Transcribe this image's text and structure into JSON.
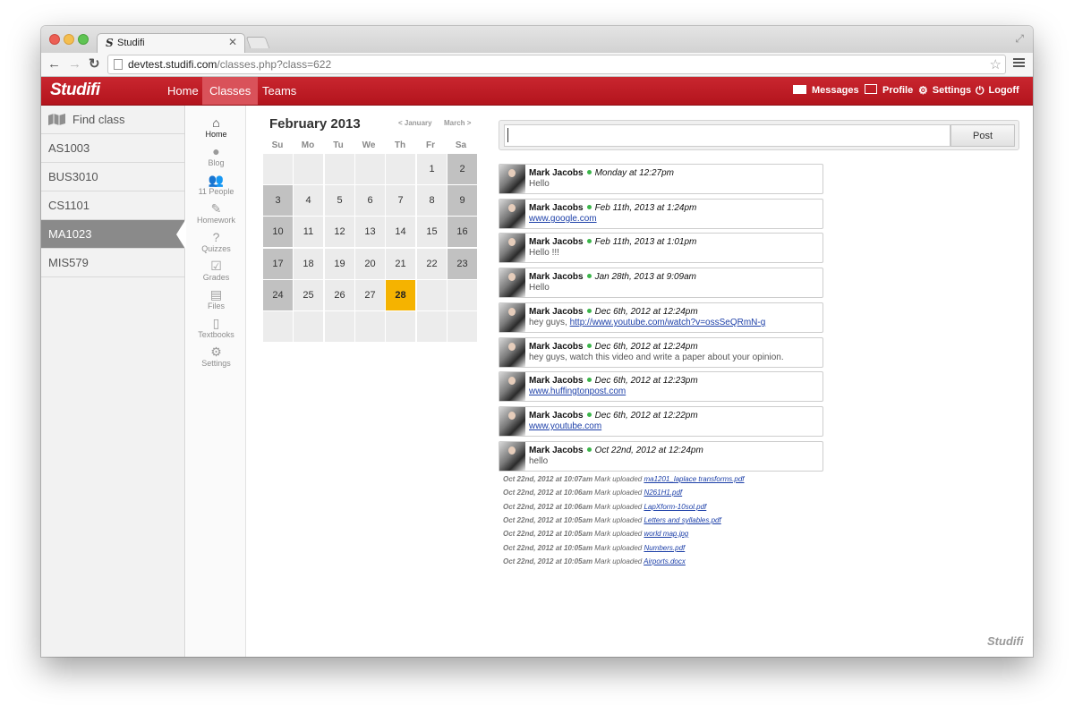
{
  "browser": {
    "tab_title": "Studifi",
    "favicon": "S",
    "url_host": "devtest.studifi.com",
    "url_path": "/classes.php?class=622"
  },
  "header": {
    "logo": "Studifi",
    "nav": [
      {
        "label": "Home"
      },
      {
        "label": "Classes"
      },
      {
        "label": "Teams"
      }
    ],
    "right": [
      {
        "label": "Messages",
        "icon": "envelope-icon"
      },
      {
        "label": "Profile",
        "icon": "id-card-icon"
      },
      {
        "label": "Settings",
        "icon": "gears-icon"
      },
      {
        "label": "Logoff",
        "icon": "power-icon"
      }
    ],
    "colors": {
      "brand": "#c0202a",
      "active_nav": "#d9525a"
    }
  },
  "sidebar": {
    "find_class": "Find class",
    "classes": [
      {
        "label": "AS1003"
      },
      {
        "label": "BUS3010"
      },
      {
        "label": "CS1101"
      },
      {
        "label": "MA1023",
        "active": true
      },
      {
        "label": "MIS579"
      }
    ]
  },
  "rail": [
    {
      "label": "Home",
      "icon": "house-icon"
    },
    {
      "label": "Blog",
      "icon": "chat-bubble-icon"
    },
    {
      "label": "11 People",
      "icon": "people-icon"
    },
    {
      "label": "Homework",
      "icon": "pencil-icon"
    },
    {
      "label": "Quizzes",
      "icon": "question-icon"
    },
    {
      "label": "Grades",
      "icon": "checkmark-icon"
    },
    {
      "label": "Files",
      "icon": "folder-icon"
    },
    {
      "label": "Textbooks",
      "icon": "book-icon"
    },
    {
      "label": "Settings",
      "icon": "gear-icon"
    }
  ],
  "calendar": {
    "title": "February 2013",
    "prev": "< January",
    "next": "March >",
    "weekdays": [
      "Su",
      "Mo",
      "Tu",
      "We",
      "Th",
      "Fr",
      "Sa"
    ],
    "weeks": [
      [
        "",
        "",
        "",
        "",
        "",
        "1",
        "2"
      ],
      [
        "3",
        "4",
        "5",
        "6",
        "7",
        "8",
        "9"
      ],
      [
        "10",
        "11",
        "12",
        "13",
        "14",
        "15",
        "16"
      ],
      [
        "17",
        "18",
        "19",
        "20",
        "21",
        "22",
        "23"
      ],
      [
        "24",
        "25",
        "26",
        "27",
        "28",
        "",
        ""
      ],
      [
        "",
        "",
        "",
        "",
        "",
        "",
        ""
      ]
    ],
    "today": "28",
    "today_color": "#f5b300"
  },
  "composer": {
    "input_value": "",
    "post_label": "Post"
  },
  "feed": [
    {
      "author": "Mark Jacobs",
      "time": "Monday at 12:27pm",
      "text": "Hello",
      "link": ""
    },
    {
      "author": "Mark Jacobs",
      "time": "Feb 11th, 2013 at 1:24pm",
      "text": "",
      "link": "www.google.com"
    },
    {
      "author": "Mark Jacobs",
      "time": "Feb 11th, 2013 at 1:01pm",
      "text": "Hello !!!",
      "link": ""
    },
    {
      "author": "Mark Jacobs",
      "time": "Jan 28th, 2013 at 9:09am",
      "text": "Hello",
      "link": ""
    },
    {
      "author": "Mark Jacobs",
      "time": "Dec 6th, 2012 at 12:24pm",
      "text": "hey guys, ",
      "link": "http://www.youtube.com/watch?v=ossSeQRmN-g"
    },
    {
      "author": "Mark Jacobs",
      "time": "Dec 6th, 2012 at 12:24pm",
      "text": "hey guys, watch this video and write a paper about your opinion.",
      "link": ""
    },
    {
      "author": "Mark Jacobs",
      "time": "Dec 6th, 2012 at 12:23pm",
      "text": "",
      "link": "www.huffingtonpost.com"
    },
    {
      "author": "Mark Jacobs",
      "time": "Dec 6th, 2012 at 12:22pm",
      "text": "",
      "link": "www.youtube.com"
    },
    {
      "author": "Mark Jacobs",
      "time": "Oct 22nd, 2012 at 12:24pm",
      "text": "hello",
      "link": ""
    }
  ],
  "uploads": [
    {
      "time": "Oct 22nd, 2012 at 10:07am",
      "action": "Mark uploaded",
      "file": "ma1201_laplace transforms.pdf"
    },
    {
      "time": "Oct 22nd, 2012 at 10:06am",
      "action": "Mark uploaded",
      "file": "N261H1.pdf"
    },
    {
      "time": "Oct 22nd, 2012 at 10:06am",
      "action": "Mark uploaded",
      "file": "LapXform-10sol.pdf"
    },
    {
      "time": "Oct 22nd, 2012 at 10:05am",
      "action": "Mark uploaded",
      "file": "Letters and syllables.pdf"
    },
    {
      "time": "Oct 22nd, 2012 at 10:05am",
      "action": "Mark uploaded",
      "file": "world map.jpg"
    },
    {
      "time": "Oct 22nd, 2012 at 10:05am",
      "action": "Mark uploaded",
      "file": "Numbers.pdf"
    },
    {
      "time": "Oct 22nd, 2012 at 10:05am",
      "action": "Mark uploaded",
      "file": "Airports.docx"
    }
  ],
  "footer_brand": "Studifi"
}
